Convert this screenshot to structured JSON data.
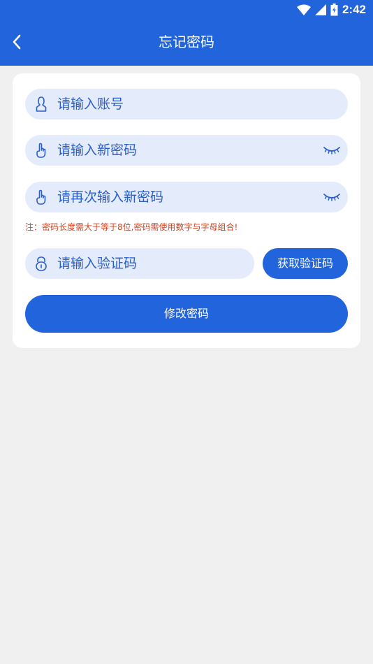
{
  "status_bar": {
    "time": "2:42",
    "icons": [
      "wifi-icon",
      "signal-icon",
      "battery-icon"
    ]
  },
  "header": {
    "title": "忘记密码",
    "back_icon": "chevron-left-icon"
  },
  "form": {
    "account": {
      "placeholder": "请输入账号",
      "value": "",
      "icon": "user-icon"
    },
    "new_password": {
      "placeholder": "请输入新密码",
      "value": "",
      "icon": "finger-icon",
      "toggle_icon": "eye-closed-icon"
    },
    "confirm_password": {
      "placeholder": "请再次输入新密码",
      "value": "",
      "icon": "finger-icon",
      "toggle_icon": "eye-closed-icon"
    },
    "hint": "注：密码长度需大于等于8位,密码需使用数字与字母组合!",
    "verification_code": {
      "placeholder": "请输入验证码",
      "value": "",
      "icon": "lock-icon"
    },
    "get_code_label": "获取验证码",
    "submit_label": "修改密码"
  },
  "colors": {
    "primary": "#2264dc",
    "field_bg": "#e4ebfb",
    "field_text": "#2b5fc9",
    "hint": "#d8401f",
    "page_bg": "#f0f0f0"
  }
}
